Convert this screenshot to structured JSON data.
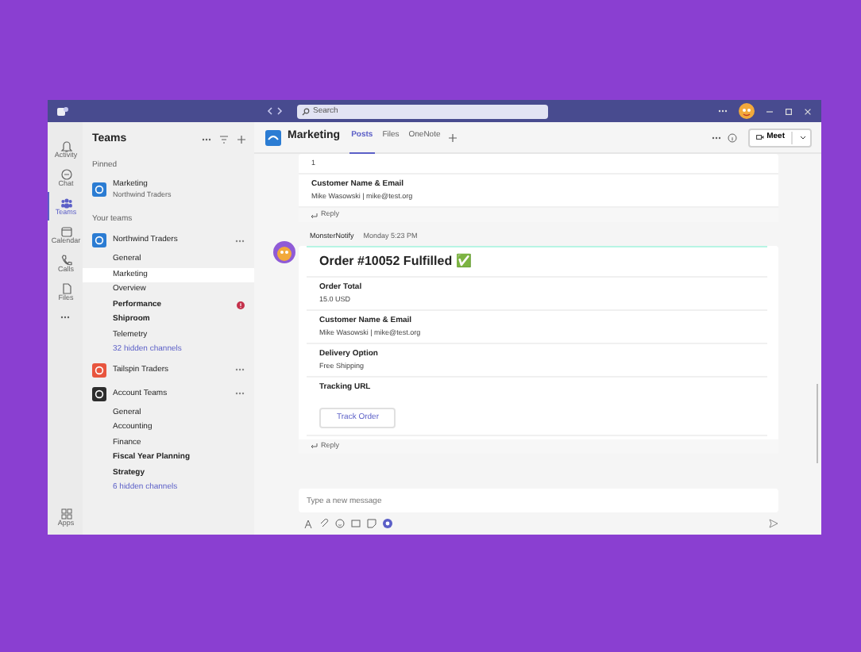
{
  "title_bar": {
    "search_placeholder": "Search"
  },
  "rail": [
    {
      "label": "Activity",
      "selected": false
    },
    {
      "label": "Chat",
      "selected": false
    },
    {
      "label": "Teams",
      "selected": true
    },
    {
      "label": "Calendar",
      "selected": false
    },
    {
      "label": "Calls",
      "selected": false
    },
    {
      "label": "Files",
      "selected": false
    }
  ],
  "rail_bottom": {
    "label": "Apps"
  },
  "sidebar": {
    "title": "Teams",
    "pinned_label": "Pinned",
    "pinned": [
      {
        "name": "Marketing",
        "subtitle": "Northwind Traders",
        "color": "#2b7cd3"
      }
    ],
    "teams_label": "Your teams",
    "teams": [
      {
        "name": "Northwind Traders",
        "color": "#2b7cd3",
        "channels": [
          {
            "name": "General",
            "unread": false,
            "selected": false,
            "alert": false
          },
          {
            "name": "Marketing",
            "unread": false,
            "selected": true,
            "alert": false
          },
          {
            "name": "Overview",
            "unread": false,
            "selected": false,
            "alert": false
          },
          {
            "name": "Performance",
            "unread": true,
            "selected": false,
            "alert": true
          },
          {
            "name": "Shiproom",
            "unread": true,
            "selected": false,
            "alert": false
          },
          {
            "name": "Telemetry",
            "unread": false,
            "selected": false,
            "alert": false
          }
        ],
        "hidden": "32 hidden channels"
      },
      {
        "name": "Tailspin Traders",
        "color": "#e8553e"
      },
      {
        "name": "Account Teams",
        "color": "#2d2d2d",
        "channels": [
          {
            "name": "General",
            "unread": false,
            "selected": false,
            "alert": false
          },
          {
            "name": "Accounting",
            "unread": false,
            "selected": false,
            "alert": false
          },
          {
            "name": "Finance",
            "unread": false,
            "selected": false,
            "alert": false
          },
          {
            "name": "Fiscal Year Planning",
            "unread": true,
            "selected": false,
            "alert": false
          },
          {
            "name": "Strategy",
            "unread": true,
            "selected": false,
            "alert": false
          }
        ],
        "hidden": "6 hidden channels"
      }
    ]
  },
  "channel_header": {
    "name": "Marketing",
    "tabs": [
      {
        "label": "Posts",
        "selected": true
      },
      {
        "label": "Files",
        "selected": false
      },
      {
        "label": "OneNote",
        "selected": false
      }
    ],
    "meet": "Meet"
  },
  "messages": [
    {
      "top_value": "1",
      "fields": [
        {
          "label": "Customer Name & Email",
          "value": "Mike Wasowski | mike@test.org"
        }
      ],
      "reply": "Reply"
    },
    {
      "author": "MonsterNotify",
      "time": "Monday 5:23 PM",
      "title": "Order #10052 Fulfilled ✅",
      "fields": [
        {
          "label": "Order Total",
          "value": "15.0 USD"
        },
        {
          "label": "Customer Name & Email",
          "value": "Mike Wasowski | mike@test.org"
        },
        {
          "label": "Delivery Option",
          "value": "Free Shipping"
        },
        {
          "label": "Tracking URL",
          "button": "Track Order"
        }
      ],
      "reply": "Reply"
    }
  ],
  "compose": {
    "placeholder": "Type a new message"
  }
}
